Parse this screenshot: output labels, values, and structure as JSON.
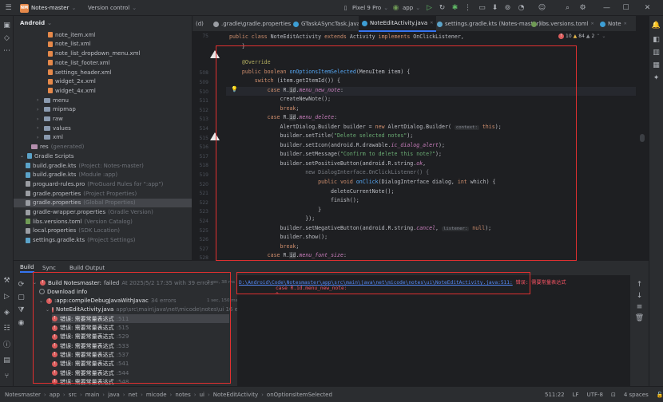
{
  "titlebar": {
    "menu_icon": "hamburger-icon",
    "project_badge": "NM",
    "project_name": "Notes-master",
    "vcs": "Version control",
    "device": "Pixel 9 Pro",
    "run_config": "app"
  },
  "project_panel": {
    "title": "Android",
    "items": [
      {
        "label": "note_item.xml",
        "type": "xml",
        "indent": 5
      },
      {
        "label": "note_list.xml",
        "type": "xml",
        "indent": 5
      },
      {
        "label": "note_list_dropdown_menu.xml",
        "type": "xml",
        "indent": 5
      },
      {
        "label": "note_list_footer.xml",
        "type": "xml",
        "indent": 5
      },
      {
        "label": "settings_header.xml",
        "type": "xml",
        "indent": 5
      },
      {
        "label": "widget_2x.xml",
        "type": "xml",
        "indent": 5
      },
      {
        "label": "widget_4x.xml",
        "type": "xml",
        "indent": 5
      },
      {
        "label": "menu",
        "type": "folder",
        "indent": 3,
        "arrow": "›"
      },
      {
        "label": "mipmap",
        "type": "folder",
        "indent": 3,
        "arrow": "›"
      },
      {
        "label": "raw",
        "type": "folder",
        "indent": 3,
        "arrow": "›"
      },
      {
        "label": "values",
        "type": "folder",
        "indent": 3,
        "arrow": "›"
      },
      {
        "label": "xml",
        "type": "folder",
        "indent": 3,
        "arrow": "›"
      },
      {
        "label": "res",
        "suffix": "(generated)",
        "type": "res",
        "indent": 2
      },
      {
        "label": "Gradle Scripts",
        "type": "gradle",
        "indent": 0,
        "arrow": "⌄"
      },
      {
        "label": "build.gradle.kts",
        "suffix": "(Project: Notes-master)",
        "type": "gradle",
        "indent": 1
      },
      {
        "label": "build.gradle.kts",
        "suffix": "(Module :app)",
        "type": "gradle",
        "indent": 1
      },
      {
        "label": "proguard-rules.pro",
        "suffix": "(ProGuard Rules for \":app\")",
        "type": "prop",
        "indent": 1
      },
      {
        "label": "gradle.properties",
        "suffix": "(Project Properties)",
        "type": "prop",
        "indent": 1
      },
      {
        "label": "gradle.properties",
        "suffix": "(Global Properties)",
        "type": "prop",
        "indent": 1,
        "selected": true
      },
      {
        "label": "gradle-wrapper.properties",
        "suffix": "(Gradle Version)",
        "type": "prop",
        "indent": 1
      },
      {
        "label": "libs.versions.toml",
        "suffix": "(Version Catalog)",
        "type": "toml",
        "indent": 1
      },
      {
        "label": "local.properties",
        "suffix": "(SDK Location)",
        "type": "prop",
        "indent": 1
      },
      {
        "label": "settings.gradle.kts",
        "suffix": "(Project Settings)",
        "type": "gradle",
        "indent": 1
      }
    ]
  },
  "tabs": [
    {
      "label": "(d)",
      "icon": ""
    },
    {
      "label": ".gradle\\gradle.properties",
      "icon": "prop"
    },
    {
      "label": "GTaskASyncTask.java",
      "icon": "java"
    },
    {
      "label": "NoteEditActivity.java",
      "icon": "java",
      "active": true
    },
    {
      "label": "settings.gradle.kts (Notes-master)",
      "icon": "kt"
    },
    {
      "label": "libs.versions.toml",
      "icon": "toml"
    },
    {
      "label": "Note",
      "icon": "java"
    }
  ],
  "editor": {
    "inspection": {
      "errors": "10",
      "warnings": "84",
      "weak": "2"
    },
    "line_numbers": [
      "75",
      "",
      "",
      "",
      "508",
      "509",
      "510",
      "511",
      "512",
      "513",
      "514",
      "515",
      "516",
      "517",
      "518",
      "519",
      "520",
      "521",
      "522",
      "523",
      "524",
      "525",
      "526",
      "527",
      "528",
      "529",
      "530",
      "531",
      "532",
      "533",
      "534",
      "535"
    ]
  },
  "build_panel": {
    "tabs": [
      "Build",
      "Sync",
      "Build Output"
    ],
    "tree": [
      {
        "label": "Build Notesmaster:",
        "status": "failed",
        "detail": "At 2025/5/2 17:35 with 39 errors",
        "time": "2 sec, 38 ms",
        "kind": "error",
        "level": 0
      },
      {
        "label": "Download info",
        "kind": "dl",
        "level": 1
      },
      {
        "label": ":app:compileDebugJavaWithJavac",
        "detail": "34 errors",
        "time": "1 sec, 150 ms",
        "kind": "error",
        "level": 1
      },
      {
        "label": "NoteEditActivity.java",
        "detail": "app\\src\\main\\java\\net\\micode\\notes\\ui 16 errors",
        "kind": "error",
        "level": 2
      },
      {
        "label": "错误: 需要常量表达式",
        "detail": ":511",
        "kind": "error",
        "level": 3,
        "selected": true
      },
      {
        "label": "错误: 需要常量表达式",
        "detail": ":515",
        "kind": "error",
        "level": 3
      },
      {
        "label": "错误: 需要常量表达式",
        "detail": ":529",
        "kind": "error",
        "level": 3
      },
      {
        "label": "错误: 需要常量表达式",
        "detail": ":533",
        "kind": "error",
        "level": 3
      },
      {
        "label": "错误: 需要常量表达式",
        "detail": ":537",
        "kind": "error",
        "level": 3
      },
      {
        "label": "错误: 需要常量表达式",
        "detail": ":541",
        "kind": "error",
        "level": 3
      },
      {
        "label": "错误: 需要常量表达式",
        "detail": ":544",
        "kind": "error",
        "level": 3
      },
      {
        "label": "错误: 需要常量表达式",
        "detail": ":548",
        "kind": "error",
        "level": 3
      }
    ],
    "output_path": "D:\\Android\\Code\\Notesmaster\\app\\src\\main\\java\\net\\micode\\notes\\ui\\NoteEditActivity.java:511:",
    "output_error": "错误: 需要常量表达式",
    "output_line2": "case R.id.menu_new_note:",
    "output_caret": "^"
  },
  "statusbar": {
    "crumbs": [
      "Notesmaster",
      "app",
      "src",
      "main",
      "java",
      "net",
      "micode",
      "notes",
      "ui",
      "NoteEditActivity",
      "onOptionsItemSelected"
    ],
    "position": "511:22",
    "line_sep": "LF",
    "encoding": "UTF-8",
    "indent": "4 spaces"
  },
  "colors": {
    "accent": "#3574f0",
    "error": "#db5c5c",
    "highlight_box": "#e03030"
  }
}
